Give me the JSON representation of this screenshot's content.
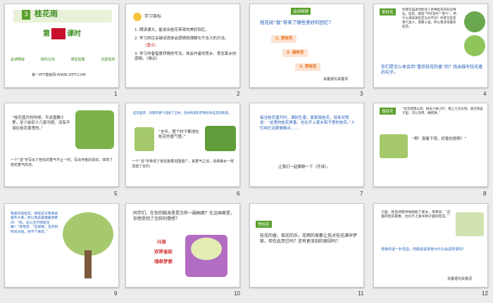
{
  "colors": {
    "accent_green": "#5aa02c",
    "title_red": "#c8102e",
    "red": "#d32f2f",
    "blue": "#1e5bb8",
    "orange": "#e8721c"
  },
  "slide_numbers": [
    "1",
    "2",
    "3",
    "4",
    "5",
    "6",
    "7",
    "8",
    "9",
    "10",
    "11",
    "12"
  ],
  "s1": {
    "badge": "3",
    "title": "桂花雨",
    "lesson_pre": "第",
    "lesson_post": "课时",
    "tags": [
      "品读释疑",
      "结构主线",
      "课堂拓展",
      "当堂检测"
    ],
    "footer": "第一PPT模板网-WWW.1PPT.COM"
  },
  "s2": {
    "heading": "学习目标",
    "goals": [
      "1. 朗读课文，能说出桂花带来的美好回忆。",
      "2. 学习抓住关键词语体会感情和理解句子含义的方法。",
      "（重点）",
      "3. 学习作者借景抒情的写法，体会作者的思乡、思念家乡的感情。（难点）"
    ]
  },
  "s3": {
    "banner": "品读释疑",
    "question": "桂花给“我”带来了哪些美好的回忆？",
    "items": [
      "1. 爱桂花",
      "2. 摇桂花",
      "3. 思桂花"
    ],
    "footer": "关键语句关键词"
  },
  "s4": {
    "tag": "爱桂花",
    "text": "作者在描述时抓住了各种桂花的形态特征。桂花，那是“不开花时”“香气”。用什么来表现桂花与众不同？作者写桂花香气迷人，香飘十里，所以我非常喜欢桂花。",
    "question": "你们是怎么体会到“喜欢桂花的香”的？找出描写桂花香的句子。"
  },
  "s5": {
    "quote": "“桂花盛开的时候，不说香飘十里，至少前后十几家邻居，没有不浸在桂花香里的。”",
    "note": "一个“浸”字写出了桂花的香气不止一时。写出作者的喜欢，体现了桂花香气的浓。"
  },
  "s6": {
    "top": "桂花盛开，浓郁的香气浸透了全村，连村民家的衣物也有桂花的味道。",
    "quote": "“全年，整个村子都浸在桂花的香气里。”",
    "note": "一个“浸”字表现了桂花飘香范围很广，其香气之浓，浓得像水一样浸透了全村。"
  },
  "s7": {
    "para": "每当桂花盛开时，满树生香。家家摇桂花，母亲对我说：“这里的桂花再香，也比不上家乡院子里的桂花。”人们用它泡茶做糕点……",
    "prompt": "让我们一起聊聊一下（齐读）。"
  },
  "s8": {
    "tag": "摇桂花",
    "text": "“桂花摇落以后，挑去小枝小叶，晒上几天太阳，收在铁盒子里，可以泡茶，做糕饼。”",
    "quote": "“啊！真像下雨，好香的雨啊！”"
  },
  "s9": {
    "text": "我喜欢摇桂花。摇桂花对我来说是件大事。所以我总是缠着母亲问：“妈，怎么还不摇桂花嘛？”母亲说：“还早呢，花开的时间太短，摇不下来的。”",
    "caption": ""
  },
  "s10": {
    "question": "同学们，在你的脑海里是怎样一副画面？在这画面里，你感受到了怎样的情感？",
    "words": [
      "兴奋",
      "欢呼雀跃",
      "魂牵梦萦"
    ]
  },
  "s11": {
    "tag": "思桂花",
    "question": "桂花的香，摇花的乐，花雨的美都让我对桂花满孕梦家，但仅此而已吗？还有更深刻的原因吗？"
  },
  "s12": {
    "text": "于是，我自然而然地想起了家乡。母亲说：“这里的桂花再香，也比不上家乡院子里的桂花。”",
    "question": "母亲的话一针见血，你能说说母亲为什么会这样说吗？",
    "footer": "关键语句关键词"
  }
}
